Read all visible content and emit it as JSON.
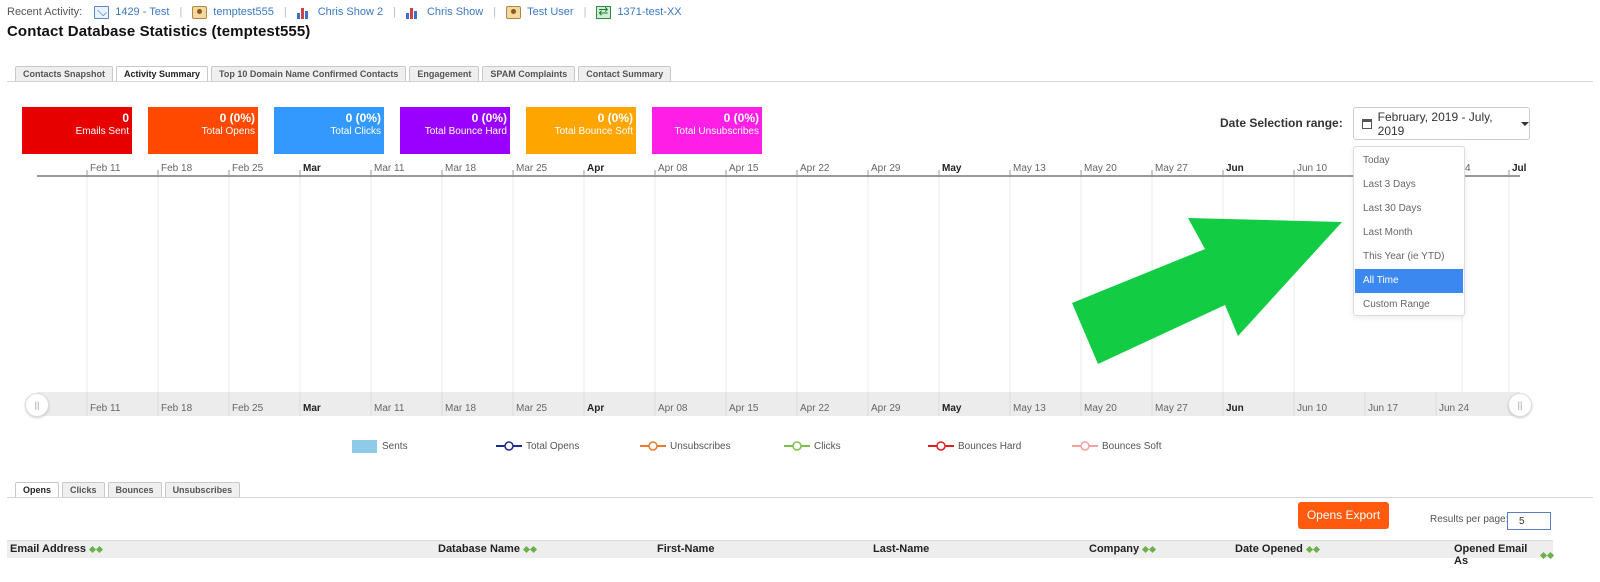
{
  "recent_activity": {
    "label": "Recent Activity:",
    "items": [
      {
        "icon": "mail-icon",
        "text": "1429 - Test"
      },
      {
        "icon": "user-icon",
        "text": "temptest555"
      },
      {
        "icon": "chart-icon",
        "text": "Chris Show 2"
      },
      {
        "icon": "chart-icon",
        "text": "Chris Show"
      },
      {
        "icon": "user-icon",
        "text": "Test User"
      },
      {
        "icon": "excel-icon",
        "text": "1371-test-XX"
      }
    ]
  },
  "page_title": "Contact Database Statistics (temptest555)",
  "top_tabs": [
    {
      "label": "Contacts Snapshot",
      "active": false
    },
    {
      "label": "Activity Summary",
      "active": true
    },
    {
      "label": "Top 10 Domain Name Confirmed Contacts",
      "active": false
    },
    {
      "label": "Engagement",
      "active": false
    },
    {
      "label": "SPAM Complaints",
      "active": false
    },
    {
      "label": "Contact Summary",
      "active": false
    }
  ],
  "stats": [
    {
      "value": "0",
      "label": "Emails Sent",
      "color": "#e60000"
    },
    {
      "value": "0 (0%)",
      "label": "Total Opens",
      "color": "#ff4800"
    },
    {
      "value": "0 (0%)",
      "label": "Total Clicks",
      "color": "#3399ff"
    },
    {
      "value": "0 (0%)",
      "label": "Total Bounce Hard",
      "color": "#9900ff"
    },
    {
      "value": "0 (0%)",
      "label": "Total Bounce Soft",
      "color": "#ffa500"
    },
    {
      "value": "0 (0%)",
      "label": "Total Unsubscribes",
      "color": "#ff1ee6"
    }
  ],
  "date_selection": {
    "label": "Date Selection range:",
    "value": "February, 2019 - July, 2019",
    "options": [
      {
        "label": "Today",
        "selected": false
      },
      {
        "label": "Last 3 Days",
        "selected": false
      },
      {
        "label": "Last 30 Days",
        "selected": false
      },
      {
        "label": "Last Month",
        "selected": false
      },
      {
        "label": "This Year (ie YTD)",
        "selected": false
      },
      {
        "label": "All Time",
        "selected": true
      },
      {
        "label": "Custom Range",
        "selected": false
      }
    ]
  },
  "timeline": {
    "top_ticks": [
      {
        "label": "Feb 11",
        "bold": false
      },
      {
        "label": "Feb 18",
        "bold": false
      },
      {
        "label": "Feb 25",
        "bold": false
      },
      {
        "label": "Mar",
        "bold": true
      },
      {
        "label": "Mar 11",
        "bold": false
      },
      {
        "label": "Mar 18",
        "bold": false
      },
      {
        "label": "Mar 25",
        "bold": false
      },
      {
        "label": "Apr",
        "bold": true
      },
      {
        "label": "Apr 08",
        "bold": false
      },
      {
        "label": "Apr 15",
        "bold": false
      },
      {
        "label": "Apr 22",
        "bold": false
      },
      {
        "label": "Apr 29",
        "bold": false
      },
      {
        "label": "May",
        "bold": true
      },
      {
        "label": "May 13",
        "bold": false
      },
      {
        "label": "May 20",
        "bold": false
      },
      {
        "label": "May 27",
        "bold": false
      },
      {
        "label": "Jun",
        "bold": true
      },
      {
        "label": "Jun 10",
        "bold": false
      },
      {
        "label": "4",
        "bold": false
      },
      {
        "label": "Jul",
        "bold": true
      }
    ],
    "navigator_ticks": [
      {
        "label": "Feb 11",
        "bold": false
      },
      {
        "label": "Feb 18",
        "bold": false
      },
      {
        "label": "Feb 25",
        "bold": false
      },
      {
        "label": "Mar",
        "bold": true
      },
      {
        "label": "Mar 11",
        "bold": false
      },
      {
        "label": "Mar 18",
        "bold": false
      },
      {
        "label": "Mar 25",
        "bold": false
      },
      {
        "label": "Apr",
        "bold": true
      },
      {
        "label": "Apr 08",
        "bold": false
      },
      {
        "label": "Apr 15",
        "bold": false
      },
      {
        "label": "Apr 22",
        "bold": false
      },
      {
        "label": "Apr 29",
        "bold": false
      },
      {
        "label": "May",
        "bold": true
      },
      {
        "label": "May 13",
        "bold": false
      },
      {
        "label": "May 20",
        "bold": false
      },
      {
        "label": "May 27",
        "bold": false
      },
      {
        "label": "Jun",
        "bold": true
      },
      {
        "label": "Jun 10",
        "bold": false
      },
      {
        "label": "Jun 17",
        "bold": false
      },
      {
        "label": "Jun 24",
        "bold": false
      }
    ],
    "navigator_handle_glyph": "||"
  },
  "legend": [
    {
      "label": "Sents",
      "kind": "bar",
      "color": "#8fcbe9"
    },
    {
      "label": "Total Opens",
      "kind": "line",
      "color": "#1f2a8a"
    },
    {
      "label": "Unsubscribes",
      "kind": "line",
      "color": "#f07a2a"
    },
    {
      "label": "Clicks",
      "kind": "line",
      "color": "#7cc04b"
    },
    {
      "label": "Bounces Hard",
      "kind": "line",
      "color": "#e01e1e"
    },
    {
      "label": "Bounces Soft",
      "kind": "line",
      "color": "#f5a0a0"
    }
  ],
  "bottom_tabs": [
    {
      "label": "Opens",
      "active": true
    },
    {
      "label": "Clicks",
      "active": false
    },
    {
      "label": "Bounces",
      "active": false
    },
    {
      "label": "Unsubscribes",
      "active": false
    }
  ],
  "export_button": "Opens Export",
  "results_per_page": {
    "label": "Results per page:",
    "value": "5"
  },
  "table_columns": [
    {
      "label": "Email Address",
      "sortable": true
    },
    {
      "label": "Database Name",
      "sortable": true
    },
    {
      "label": "First-Name",
      "sortable": false
    },
    {
      "label": "Last-Name",
      "sortable": false
    },
    {
      "label": "Company",
      "sortable": true
    },
    {
      "label": "Date Opened",
      "sortable": true
    },
    {
      "label": "Opened Email As",
      "sortable": true
    }
  ],
  "colors": {
    "accent_blue": "#3b88f0",
    "export_orange": "#ff5a0d",
    "annotation_arrow": "#12cc44",
    "link": "#3b78c2"
  }
}
